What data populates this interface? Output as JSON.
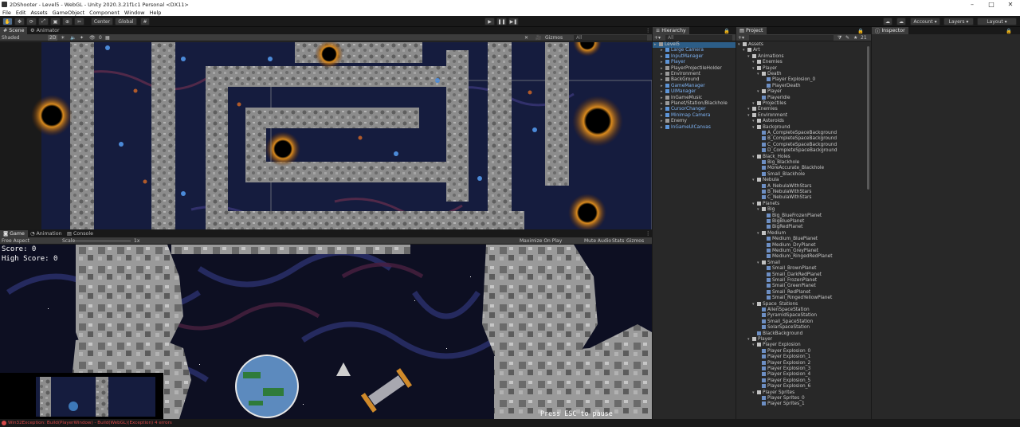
{
  "window": {
    "title": "2DShooter - Level5 - WebGL - Unity 2020.3.21f1c1 Personal <DX11>"
  },
  "menu": [
    "File",
    "Edit",
    "Assets",
    "GameObject",
    "Component",
    "Window",
    "Help"
  ],
  "toolbar": {
    "pivot": "Center",
    "space": "Global",
    "account": "Account",
    "layers": "Layers",
    "layout": "Layout"
  },
  "scene": {
    "tab_scene": "Scene",
    "tab_animator": "Animator",
    "shading": "Shaded",
    "mode_2d": "2D",
    "gizmos": "Gizmos",
    "search_placeholder": "All",
    "count": "0"
  },
  "game": {
    "tab_game": "Game",
    "tab_animation": "Animation",
    "tab_console": "Console",
    "aspect": "Free Aspect",
    "scale_label": "Scale",
    "scale_value": "1x",
    "maximize": "Maximize On Play",
    "mute": "Mute Audio",
    "stats": "Stats",
    "gizmos": "Gizmos",
    "score": "Score: 0",
    "high_score": "High Score: 0",
    "press_esc": "Press ESC to pause"
  },
  "hierarchy": {
    "title": "Hierarchy",
    "search_placeholder": "All",
    "items": [
      {
        "label": "Level5",
        "level": 0,
        "blue": false
      },
      {
        "label": "Large Camera",
        "level": 1,
        "blue": true
      },
      {
        "label": "InputManager",
        "level": 1,
        "blue": true
      },
      {
        "label": "Player",
        "level": 1,
        "blue": true
      },
      {
        "label": "PlayerProjectileHolder",
        "level": 1,
        "blue": false
      },
      {
        "label": "Environment",
        "level": 1,
        "blue": false
      },
      {
        "label": "BackGround",
        "level": 1,
        "blue": false
      },
      {
        "label": "GameManager",
        "level": 1,
        "blue": true
      },
      {
        "label": "UIManager",
        "level": 1,
        "blue": true
      },
      {
        "label": "InGameMusic",
        "level": 1,
        "blue": false
      },
      {
        "label": "Planet/Station/Blackhole",
        "level": 1,
        "blue": false
      },
      {
        "label": "CursorChanger",
        "level": 1,
        "blue": true
      },
      {
        "label": "Minimap Camera",
        "level": 1,
        "blue": true
      },
      {
        "label": "Enemy",
        "level": 1,
        "blue": false
      },
      {
        "label": "InGameUICanvas",
        "level": 1,
        "blue": true
      }
    ]
  },
  "project": {
    "title": "Project",
    "count": "21",
    "items": [
      {
        "label": "Assets",
        "level": 0
      },
      {
        "label": "Art",
        "level": 1
      },
      {
        "label": "Animations",
        "level": 2
      },
      {
        "label": "Enemies",
        "level": 3
      },
      {
        "label": "Player",
        "level": 3
      },
      {
        "label": "Death",
        "level": 4
      },
      {
        "label": "Player Explosion_0",
        "level": 5
      },
      {
        "label": "PlayerDeath",
        "level": 5
      },
      {
        "label": "Player",
        "level": 4
      },
      {
        "label": "PlayerIdle",
        "level": 4
      },
      {
        "label": "Projectiles",
        "level": 3
      },
      {
        "label": "Enemies",
        "level": 2
      },
      {
        "label": "Environment",
        "level": 2
      },
      {
        "label": "Asteroids",
        "level": 3
      },
      {
        "label": "Background",
        "level": 3
      },
      {
        "label": "A_CompleteSpaceBackground",
        "level": 4
      },
      {
        "label": "B_CompleteSpaceBackground",
        "level": 4
      },
      {
        "label": "C_CompleteSpaceBackground",
        "level": 4
      },
      {
        "label": "D_CompleteSpaceBackground",
        "level": 4
      },
      {
        "label": "Black_Holes",
        "level": 3
      },
      {
        "label": "Big_Blackhole",
        "level": 4
      },
      {
        "label": "MoreAccurate_Blackhole",
        "level": 4
      },
      {
        "label": "Small_Blackhole",
        "level": 4
      },
      {
        "label": "Nebula",
        "level": 3
      },
      {
        "label": "A_NebulaWithStars",
        "level": 4
      },
      {
        "label": "B_NebulaWithStars",
        "level": 4
      },
      {
        "label": "C_NebulaWithStars",
        "level": 4
      },
      {
        "label": "Planets",
        "level": 3
      },
      {
        "label": "Big",
        "level": 4
      },
      {
        "label": "Big_BlueFrozenPlanet",
        "level": 5
      },
      {
        "label": "BigBluePlanet",
        "level": 5
      },
      {
        "label": "BigRedPlanet",
        "level": 5
      },
      {
        "label": "Medium",
        "level": 4
      },
      {
        "label": "Medium_BluePlanet",
        "level": 5
      },
      {
        "label": "Medium_DryPlanet",
        "level": 5
      },
      {
        "label": "Medium_GreyPlanet",
        "level": 5
      },
      {
        "label": "Medium_RingedRedPlanet",
        "level": 5
      },
      {
        "label": "Small",
        "level": 4
      },
      {
        "label": "Small_BrownPlanet",
        "level": 5
      },
      {
        "label": "Small_DarkRedPlanet",
        "level": 5
      },
      {
        "label": "Small_FrozenPlanet",
        "level": 5
      },
      {
        "label": "Small_GreenPlanet",
        "level": 5
      },
      {
        "label": "Small_RedPlanet",
        "level": 5
      },
      {
        "label": "Small_RingedYellowPlanet",
        "level": 5
      },
      {
        "label": "Space_Stations",
        "level": 3
      },
      {
        "label": "AlienSpaceStation",
        "level": 4
      },
      {
        "label": "PyramidSpaceStation",
        "level": 4
      },
      {
        "label": "Small_SpaceStation",
        "level": 4
      },
      {
        "label": "SolarSpaceStation",
        "level": 4
      },
      {
        "label": "BlackBackground",
        "level": 3
      },
      {
        "label": "Player",
        "level": 2
      },
      {
        "label": "Player Explosion",
        "level": 3
      },
      {
        "label": "Player Explosion_0",
        "level": 4
      },
      {
        "label": "Player Explosion_1",
        "level": 4
      },
      {
        "label": "Player Explosion_2",
        "level": 4
      },
      {
        "label": "Player Explosion_3",
        "level": 4
      },
      {
        "label": "Player Explosion_4",
        "level": 4
      },
      {
        "label": "Player Explosion_5",
        "level": 4
      },
      {
        "label": "Player Explosion_6",
        "level": 4
      },
      {
        "label": "Player Sprites",
        "level": 3
      },
      {
        "label": "Player Sprites_0",
        "level": 4
      },
      {
        "label": "Player Sprites_1",
        "level": 4
      }
    ]
  },
  "inspector": {
    "title": "Inspector"
  },
  "status": {
    "error": "Win32Exception: Build(PlayerWindow) - Build(WebGL)(Exception) 4 errors"
  },
  "colors": {
    "accent": "#2c5d87",
    "space": "#141a3a",
    "asteroid": "#8d8d8d"
  }
}
